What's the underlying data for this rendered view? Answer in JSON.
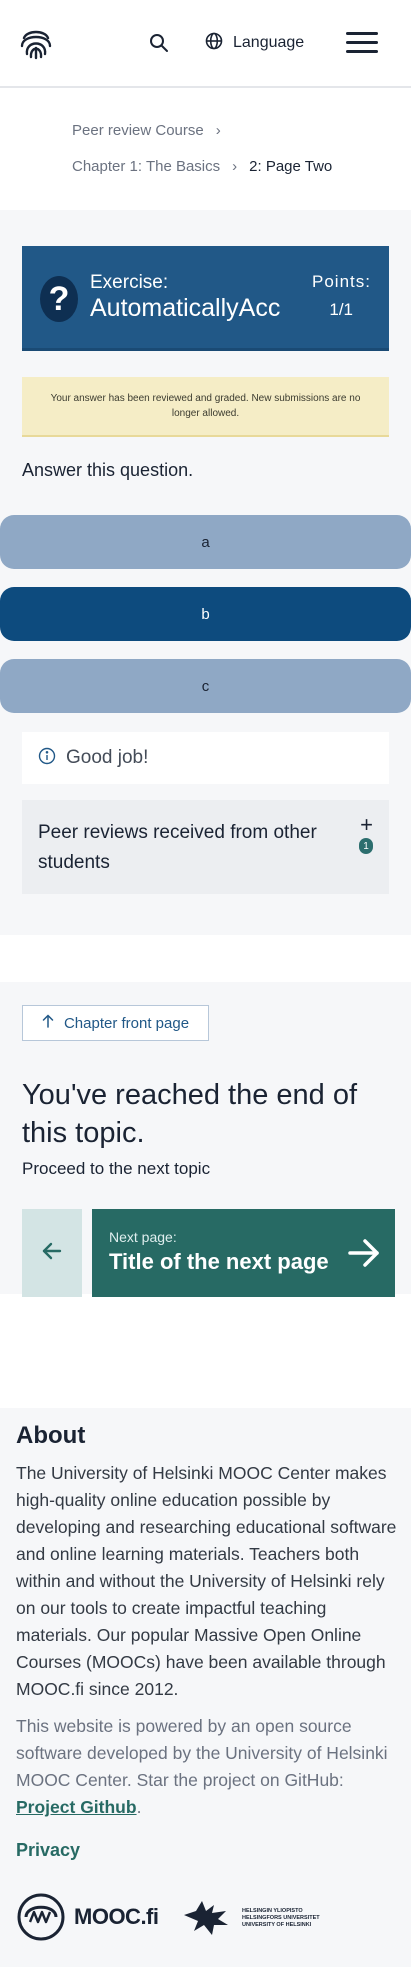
{
  "header": {
    "logo_icon": "fingerprint-icon",
    "search_icon": "search-icon",
    "language_label": "Language",
    "language_icon": "globe-icon",
    "menu_icon": "hamburger-menu-icon"
  },
  "breadcrumb": {
    "course": "Peer review Course",
    "chapter": "Chapter 1: The Basics",
    "page": "2: Page Two",
    "separator": "›"
  },
  "exercise": {
    "label": "Exercise:",
    "name": "AutomaticallyAcc",
    "points_label": "Points:",
    "points_value": "1/1",
    "icon": "question-mark-icon",
    "notice": "Your answer has been reviewed and graded. New submissions are no longer allowed.",
    "question": "Answer this question.",
    "options": [
      {
        "label": "a",
        "selected": false
      },
      {
        "label": "b",
        "selected": true
      },
      {
        "label": "c",
        "selected": false
      }
    ],
    "feedback": "Good job!",
    "feedback_icon": "info-icon",
    "peer_reviews_title": "Peer reviews received from other students",
    "peer_reviews_expand": "+",
    "peer_reviews_count": "1"
  },
  "end_of_topic": {
    "chapter_front_label": "Chapter front page",
    "title": "You've reached the end of this topic.",
    "subtitle": "Proceed to the next topic",
    "next_label": "Next page:",
    "next_title": "Title of the next page"
  },
  "footer": {
    "about_title": "About",
    "about_text": "The University of Helsinki MOOC Center makes high-quality online education possible by developing and researching educational software and online learning materials. Teachers both within and without the University of Helsinki rely on our tools to create impactful teaching materials. Our popular Massive Open Online Courses (MOOCs) have been available through MOOC.fi since 2012.",
    "powered_text": "This website is powered by an open source software developed by the University of Helsinki MOOC Center. Star the project on GitHub: ",
    "github_link": "Project Github",
    "powered_end": ".",
    "privacy": "Privacy",
    "mooc_logo_text": "MOOC.fi",
    "hy_line1": "HELSINGIN YLIOPISTO",
    "hy_line2": "HELSINGFORS UNIVERSITET",
    "hy_line3": "UNIVERSITY OF HELSINKI"
  }
}
